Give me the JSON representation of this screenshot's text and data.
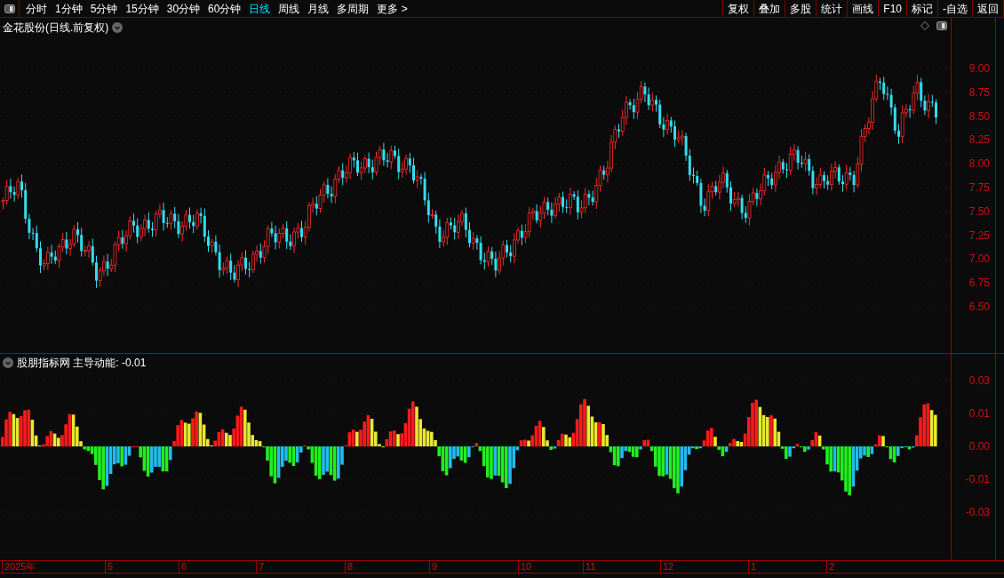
{
  "toolbar": {
    "periods": [
      {
        "label": "分时",
        "selected": false
      },
      {
        "label": "1分钟",
        "selected": false
      },
      {
        "label": "5分钟",
        "selected": false
      },
      {
        "label": "15分钟",
        "selected": false
      },
      {
        "label": "30分钟",
        "selected": false
      },
      {
        "label": "60分钟",
        "selected": false
      },
      {
        "label": "日线",
        "selected": true
      },
      {
        "label": "周线",
        "selected": false
      },
      {
        "label": "月线",
        "selected": false
      },
      {
        "label": "多周期",
        "selected": false
      },
      {
        "label": "更多 >",
        "selected": false
      }
    ],
    "actions": [
      "复权",
      "叠加",
      "多股",
      "统计",
      "画线",
      "F10",
      "标记",
      "-自选",
      "返回"
    ]
  },
  "main_chart": {
    "title": "金花股份(日线.前复权)",
    "price_axis": [
      "9.00",
      "8.75",
      "8.50",
      "8.25",
      "8.00",
      "7.75",
      "7.50",
      "7.25",
      "7.00",
      "6.75",
      "6.50"
    ]
  },
  "indicator": {
    "title": "股朋指标网 主导动能: -0.01",
    "axis": [
      "0.03",
      "0.01",
      "0.00",
      "-0.01",
      "-0.03"
    ]
  },
  "date_axis": [
    "2025年",
    "5",
    "6",
    "7",
    "8",
    "9",
    "10",
    "11",
    "12",
    "1",
    "2"
  ]
}
